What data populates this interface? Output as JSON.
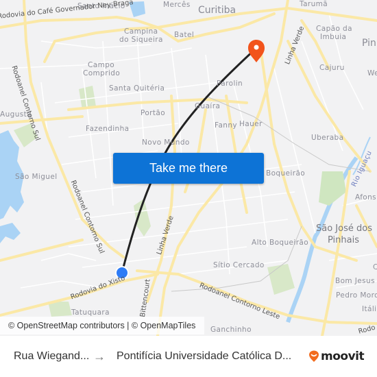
{
  "map": {
    "labels": [
      {
        "id": "santo-inacio",
        "text": "Santo Inácio"
      },
      {
        "id": "merces",
        "text": "Mercês"
      },
      {
        "id": "curitiba",
        "text": "Curitiba"
      },
      {
        "id": "taruma",
        "text": "Tarumã"
      },
      {
        "id": "campina",
        "text": "Campina"
      },
      {
        "id": "do-siqueira",
        "text": "do Siqueira"
      },
      {
        "id": "batel",
        "text": "Batel"
      },
      {
        "id": "capao-da",
        "text": "Capão da"
      },
      {
        "id": "imbuia",
        "text": "Imbuia"
      },
      {
        "id": "pinhais",
        "text": "Pinh"
      },
      {
        "id": "campo",
        "text": "Campo"
      },
      {
        "id": "comprido",
        "text": "Comprido"
      },
      {
        "id": "cajuru",
        "text": "Cajuru"
      },
      {
        "id": "we",
        "text": "We"
      },
      {
        "id": "santa-quiteria",
        "text": "Santa Quitéria"
      },
      {
        "id": "parolin",
        "text": "Parolin"
      },
      {
        "id": "augusta",
        "text": "Augusta"
      },
      {
        "id": "portao",
        "text": "Portão"
      },
      {
        "id": "guaira",
        "text": "Guaíra"
      },
      {
        "id": "fanny",
        "text": "Fanny"
      },
      {
        "id": "hauer",
        "text": "Hauer"
      },
      {
        "id": "fazendinha",
        "text": "Fazendinha"
      },
      {
        "id": "uberaba",
        "text": "Uberaba"
      },
      {
        "id": "novo-mundo",
        "text": "Novo Mundo"
      },
      {
        "id": "boqueirao",
        "text": "Boqueirão"
      },
      {
        "id": "sao-miguel",
        "text": "São Miguel"
      },
      {
        "id": "afonso",
        "text": "Afons"
      },
      {
        "id": "sjp1",
        "text": "São José dos"
      },
      {
        "id": "sjp2",
        "text": "Pinhais"
      },
      {
        "id": "alto-boqueirao",
        "text": "Alto Boqueirão"
      },
      {
        "id": "sitio-cercado",
        "text": "Sítio Cercado"
      },
      {
        "id": "bom-jesus",
        "text": "Bom Jesus"
      },
      {
        "id": "pedro-moro",
        "text": "Pedro Moro"
      },
      {
        "id": "italia",
        "text": "Itáli"
      },
      {
        "id": "tatuquara",
        "text": "Tatuquara"
      },
      {
        "id": "ganchinho",
        "text": "Ganchinho"
      },
      {
        "id": "c-east",
        "text": "C"
      }
    ],
    "roads": [
      {
        "id": "rodovia-cafe",
        "text": "Rodovia do Café Governador Ney Braga"
      },
      {
        "id": "rodoanel-sul-top",
        "text": "Rodoanel Contorno Sul"
      },
      {
        "id": "rodoanel-sul-mid",
        "text": "Rodoanel Contorno Sul"
      },
      {
        "id": "linha-verde-top",
        "text": "Linha Verde"
      },
      {
        "id": "linha-verde-mid",
        "text": "Linha Verde"
      },
      {
        "id": "rodovia-xisto",
        "text": "Rodovia do Xisto"
      },
      {
        "id": "bittencourt",
        "text": "Bittencourt"
      },
      {
        "id": "rodoanel-leste",
        "text": "Rodoanel Contorno Leste"
      },
      {
        "id": "rodo-east",
        "text": "Rodo"
      },
      {
        "id": "rio-iguacu",
        "text": "Rio Iguaçu"
      }
    ],
    "colors": {
      "background": "#f2f2f3",
      "major_road": "#fbe8a6",
      "minor_road": "#ffffff",
      "water": "#aad3f5",
      "park": "#d8e8c8",
      "route": "#222222",
      "origin_marker": "#2e7cf6",
      "destination_marker": "#f2531b"
    }
  },
  "cta": {
    "label": "Take me there",
    "color": "#0d73d6"
  },
  "attribution": "© OpenStreetMap contributors | © OpenMapTiles",
  "footer": {
    "origin": "Rua Wiegand...",
    "arrow": "→",
    "destination": "Pontifícia Universidade Católica D...",
    "brand": "moovit",
    "brand_color": "#f26b1d"
  }
}
